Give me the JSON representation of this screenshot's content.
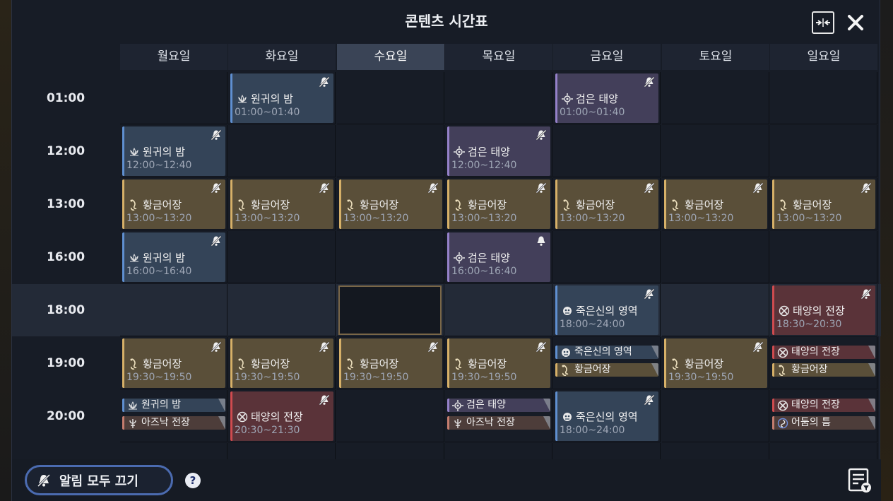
{
  "title": "콘텐츠 시간표",
  "days": [
    "월요일",
    "화요일",
    "수요일",
    "목요일",
    "금요일",
    "토요일",
    "일요일"
  ],
  "active_day_index": 2,
  "times": [
    "01:00",
    "12:00",
    "13:00",
    "16:00",
    "18:00",
    "19:00",
    "20:00"
  ],
  "highlight_row_index": 4,
  "colors": {
    "gold": "#d6b068",
    "blue": "#5f8fd0",
    "purple": "#9480c8",
    "red": "#cf4b4f",
    "brown": "#c47c6e"
  },
  "events": [
    {
      "row": 0,
      "day": 1,
      "type": "blue",
      "icon": "lotus-icon",
      "name": "원귀의 밤",
      "time": "01:00~01:40",
      "bell": "off"
    },
    {
      "row": 0,
      "day": 4,
      "type": "purple",
      "icon": "sun-target-icon",
      "name": "검은 태양",
      "time": "01:00~01:40",
      "bell": "off"
    },
    {
      "row": 1,
      "day": 0,
      "type": "blue",
      "icon": "lotus-icon",
      "name": "원귀의 밤",
      "time": "12:00~12:40",
      "bell": "off"
    },
    {
      "row": 1,
      "day": 3,
      "type": "purple",
      "icon": "sun-target-icon",
      "name": "검은 태양",
      "time": "12:00~12:40",
      "bell": "off"
    },
    {
      "row": 2,
      "day": 0,
      "type": "gold",
      "icon": "fishing-hook-icon",
      "name": "황금어장",
      "time": "13:00~13:20",
      "bell": "off"
    },
    {
      "row": 2,
      "day": 1,
      "type": "gold",
      "icon": "fishing-hook-icon",
      "name": "황금어장",
      "time": "13:00~13:20",
      "bell": "off"
    },
    {
      "row": 2,
      "day": 2,
      "type": "gold",
      "icon": "fishing-hook-icon",
      "name": "황금어장",
      "time": "13:00~13:20",
      "bell": "off"
    },
    {
      "row": 2,
      "day": 3,
      "type": "gold",
      "icon": "fishing-hook-icon",
      "name": "황금어장",
      "time": "13:00~13:20",
      "bell": "off"
    },
    {
      "row": 2,
      "day": 4,
      "type": "gold",
      "icon": "fishing-hook-icon",
      "name": "황금어장",
      "time": "13:00~13:20",
      "bell": "off"
    },
    {
      "row": 2,
      "day": 5,
      "type": "gold",
      "icon": "fishing-hook-icon",
      "name": "황금어장",
      "time": "13:00~13:20",
      "bell": "off"
    },
    {
      "row": 2,
      "day": 6,
      "type": "gold",
      "icon": "fishing-hook-icon",
      "name": "황금어장",
      "time": "13:00~13:20",
      "bell": "off"
    },
    {
      "row": 3,
      "day": 0,
      "type": "blue",
      "icon": "lotus-icon",
      "name": "원귀의 밤",
      "time": "16:00~16:40",
      "bell": "off"
    },
    {
      "row": 3,
      "day": 3,
      "type": "purple",
      "icon": "sun-target-icon",
      "name": "검은 태양",
      "time": "16:00~16:40",
      "bell": "on"
    },
    {
      "row": 4,
      "day": 4,
      "type": "blue",
      "icon": "skull-orb-icon",
      "name": "죽은신의 영역",
      "time": "18:00~24:00",
      "bell": "off"
    },
    {
      "row": 4,
      "day": 6,
      "type": "red",
      "icon": "crossed-swords-icon",
      "name": "태양의 전장",
      "time": "18:30~20:30",
      "bell": "off"
    },
    {
      "row": 5,
      "day": 0,
      "type": "gold",
      "icon": "fishing-hook-icon",
      "name": "황금어장",
      "time": "19:30~19:50",
      "bell": "off"
    },
    {
      "row": 5,
      "day": 1,
      "type": "gold",
      "icon": "fishing-hook-icon",
      "name": "황금어장",
      "time": "19:30~19:50",
      "bell": "off"
    },
    {
      "row": 5,
      "day": 2,
      "type": "gold",
      "icon": "fishing-hook-icon",
      "name": "황금어장",
      "time": "19:30~19:50",
      "bell": "off"
    },
    {
      "row": 5,
      "day": 3,
      "type": "gold",
      "icon": "fishing-hook-icon",
      "name": "황금어장",
      "time": "19:30~19:50",
      "bell": "off"
    },
    {
      "row": 5,
      "day": 5,
      "type": "gold",
      "icon": "fishing-hook-icon",
      "name": "황금어장",
      "time": "19:30~19:50",
      "bell": "off"
    },
    {
      "row": 6,
      "day": 1,
      "type": "red",
      "icon": "crossed-swords-icon",
      "name": "태양의 전장",
      "time": "20:30~21:30",
      "bell": "off"
    },
    {
      "row": 6,
      "day": 4,
      "type": "blue",
      "icon": "skull-orb-icon",
      "name": "죽은신의 영역",
      "time": "18:00~24:00",
      "bell": "off"
    }
  ],
  "small_events": [
    {
      "row": 5,
      "day": 4,
      "slot": 0,
      "type": "blue",
      "icon": "skull-orb-icon",
      "name": "죽은신의 영역"
    },
    {
      "row": 5,
      "day": 4,
      "slot": 1,
      "type": "gold",
      "icon": "fishing-hook-icon",
      "name": "황금어장"
    },
    {
      "row": 5,
      "day": 6,
      "slot": 0,
      "type": "red",
      "icon": "crossed-swords-icon",
      "name": "태양의 전장"
    },
    {
      "row": 5,
      "day": 6,
      "slot": 1,
      "type": "gold",
      "icon": "fishing-hook-icon",
      "name": "황금어장"
    },
    {
      "row": 6,
      "day": 0,
      "slot": 0,
      "type": "blue",
      "icon": "lotus-icon",
      "name": "원귀의 밤"
    },
    {
      "row": 6,
      "day": 0,
      "slot": 1,
      "type": "brown",
      "icon": "trident-icon",
      "name": "아즈낙 전장"
    },
    {
      "row": 6,
      "day": 3,
      "slot": 0,
      "type": "purple",
      "icon": "sun-target-icon",
      "name": "검은 태양"
    },
    {
      "row": 6,
      "day": 3,
      "slot": 1,
      "type": "brown",
      "icon": "trident-icon",
      "name": "아즈낙 전장"
    },
    {
      "row": 6,
      "day": 6,
      "slot": 0,
      "type": "red",
      "icon": "crossed-swords-icon",
      "name": "태양의 전장"
    },
    {
      "row": 6,
      "day": 6,
      "slot": 1,
      "type": "brown",
      "icon": "vortex-icon",
      "name": "어둠의 틈"
    }
  ],
  "bottom": {
    "alarm_off_label": "알림 모두 끄기",
    "help_label": "?"
  }
}
